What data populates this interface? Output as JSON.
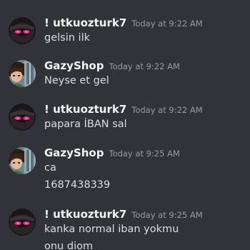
{
  "messages": [
    {
      "author": "! utkuozturk7",
      "timestamp": "Today at 9:22 AM",
      "avatar_icon": "dark-masked-avatar-icon",
      "lines": [
        "gelsin ilk"
      ]
    },
    {
      "author": "GazyShop",
      "timestamp": "Today at 9:22 AM",
      "avatar_icon": "anime-character-avatar-icon",
      "lines": [
        "Neyse et gel"
      ]
    },
    {
      "author": "! utkuozturk7",
      "timestamp": "Today at 9:22 AM",
      "avatar_icon": "dark-masked-avatar-icon",
      "lines": [
        "papara İBAN sal"
      ]
    },
    {
      "author": "GazyShop",
      "timestamp": "Today at 9:25 AM",
      "avatar_icon": "anime-character-avatar-icon",
      "lines": [
        "ca",
        "1687438339"
      ]
    },
    {
      "author": "! utkuozturk7",
      "timestamp": "Today at 9:25 AM",
      "avatar_icon": "dark-masked-avatar-icon",
      "lines": [
        "kanka normal iban yokmu",
        "onu diom"
      ]
    }
  ],
  "colors": {
    "background": "#313338",
    "username": "#f2f3f5",
    "timestamp": "#949ba4",
    "message_text": "#dbdee1"
  }
}
